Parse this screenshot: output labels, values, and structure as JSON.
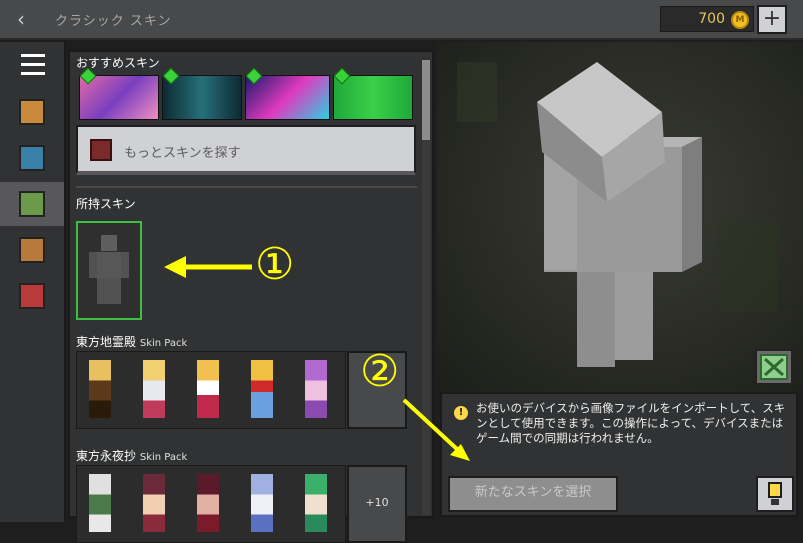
{
  "header": {
    "title": "クラシック スキン",
    "coins": "700",
    "coin_symbol": "M",
    "add_label": "+"
  },
  "sidebar": {
    "items": [
      {
        "name": "menu"
      },
      {
        "name": "featured"
      },
      {
        "name": "skins"
      },
      {
        "name": "owned"
      },
      {
        "name": "characters"
      },
      {
        "name": "emotes"
      }
    ]
  },
  "list": {
    "featured_heading": "おすすめスキン",
    "more_skins_label": "もっとスキンを探す",
    "owned_heading": "所持スキン",
    "packs": [
      {
        "name": "東方地霊殿",
        "tag": "Skin Pack",
        "more": ""
      },
      {
        "name": "東方永夜抄",
        "tag": "Skin Pack",
        "more": "+10"
      }
    ]
  },
  "info": {
    "text": "お使いのデバイスから画像ファイルをインポートして、スキンとして使用できます。この操作によって、デバイスまたはゲーム間での同期は行われません。",
    "choose_button": "新たなスキンを選択"
  },
  "annotations": {
    "one": "①",
    "two": "②",
    "color": "#ffff00"
  },
  "colors": {
    "accent_green": "#3cbf3c",
    "coin": "#f0c020"
  }
}
